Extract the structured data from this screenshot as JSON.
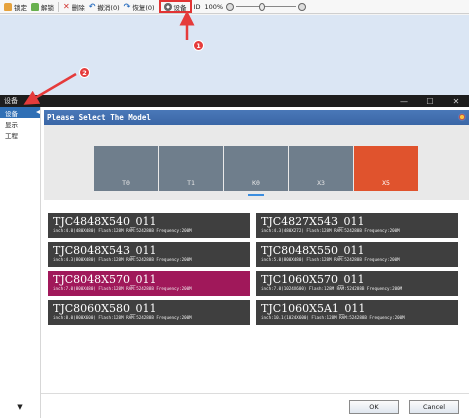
{
  "toolbar": {
    "lock_label": "锁定",
    "unlock_label": "解锁",
    "delete_label": "删除",
    "undo_label": "撤消(0)",
    "redo_label": "恢复(0)",
    "settings_label": "设备",
    "id_label": "ID",
    "zoom_value": "100%",
    "zoom_level": 0.43
  },
  "annotations": {
    "badge_1": "1",
    "badge_2": "2",
    "color": "#e53b3b"
  },
  "dialog": {
    "title": "设备",
    "controls": {
      "minimize": "—",
      "maximize": "☐",
      "close": "✕"
    },
    "sidebar": {
      "items": [
        {
          "label": "设备",
          "active": true
        },
        {
          "label": "显示",
          "active": false
        },
        {
          "label": "工程",
          "active": false
        }
      ],
      "scroll_down": "▼"
    },
    "header": "Please Select The Model",
    "series": [
      {
        "label": "T0",
        "selected": false
      },
      {
        "label": "T1",
        "selected": false
      },
      {
        "label": "K0",
        "selected": false
      },
      {
        "label": "X3",
        "selected": false
      },
      {
        "label": "X5",
        "selected": true
      }
    ],
    "models": [
      {
        "name": "TJC4848X540_011",
        "spec": "inch:4.0(480X480) Flash:128M RAM:524288B Frequency:200M",
        "selected": false
      },
      {
        "name": "TJC4827X543_011",
        "spec": "inch:4.3(480X272) Flash:128M RAM:524288B Frequency:200M",
        "selected": false
      },
      {
        "name": "TJC8048X543_011",
        "spec": "inch:4.3(800X480) Flash:128M RAM:524288B Frequency:200M",
        "selected": false
      },
      {
        "name": "TJC8048X550_011",
        "spec": "inch:5.0(800X480) Flash:128M RAM:524288B Frequency:200M",
        "selected": false
      },
      {
        "name": "TJC8048X570_011",
        "spec": "inch:7.0(800X480) Flash:128M RAM:524288B Frequency:200M",
        "selected": true
      },
      {
        "name": "TJC1060X570_011",
        "spec": "inch:7.0(1024X600) Flash:128M RAM:524288B Frequency:200M",
        "selected": false
      },
      {
        "name": "TJC8060X580_011",
        "spec": "inch:8.0(800X600) Flash:128M RAM:524288B Frequency:200M",
        "selected": false
      },
      {
        "name": "TJC1060X5A1_011",
        "spec": "inch:10.1(1024X600) Flash:128M RAM:524288B Frequency:200M",
        "selected": false
      }
    ],
    "ok_label": "OK",
    "cancel_label": "Cancel",
    "colors": {
      "header_blue": "#3f6dad",
      "series_tile": "#6f7e8c",
      "series_selected": "#e0532d",
      "model_card": "#3f3f3f",
      "model_selected": "#a0185a"
    }
  }
}
